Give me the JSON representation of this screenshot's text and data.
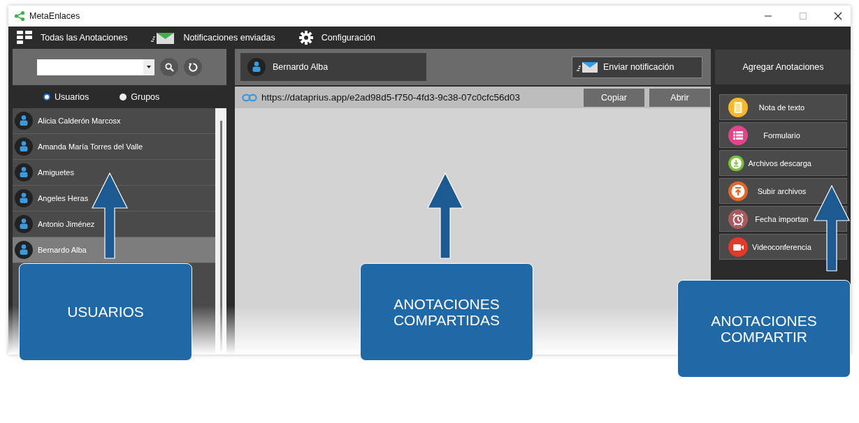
{
  "window": {
    "title": "MetaEnlaces"
  },
  "menu": [
    {
      "label": "Todas las Anotaciones",
      "kind": "grid"
    },
    {
      "label": "Notificaciones enviadas",
      "kind": "mail"
    },
    {
      "label": "Configuración",
      "kind": "gear"
    }
  ],
  "sidebar": {
    "filter": [
      {
        "label": "Usuarios",
        "selected": true
      },
      {
        "label": "Grupos",
        "selected": false
      }
    ],
    "users": [
      {
        "name": "Alicia Calderón Marcosx",
        "selected": false
      },
      {
        "name": "Amanda María Torres del Valle",
        "selected": false
      },
      {
        "name": "Amiguetes",
        "selected": false
      },
      {
        "name": "Angeles Heras",
        "selected": false
      },
      {
        "name": "Antonio Jiménez",
        "selected": false
      },
      {
        "name": "Bernardo Alba",
        "selected": true
      }
    ]
  },
  "conversation": {
    "user": "Bernardo Alba",
    "send_button": "Enviar notificación",
    "link": {
      "url": "https://dataprius.app/e2ad98d5-f750-4fd3-9c38-07c0cfc56d03",
      "buttons": [
        "Copiar",
        "Abrir"
      ]
    }
  },
  "annotations": {
    "title": "Agregar Anotaciones",
    "items": [
      {
        "label": "Nota de texto",
        "kind": "note",
        "color": "#f7b829"
      },
      {
        "label": "Formulario",
        "kind": "form",
        "color": "#e0468c"
      },
      {
        "label": "Archivos descarga",
        "kind": "download",
        "color": "#7cbf3a"
      },
      {
        "label": "Subir archivos",
        "kind": "upload",
        "color": "#e0672a"
      },
      {
        "label": "Fecha importan",
        "kind": "alarm",
        "color": "#a85a5e"
      },
      {
        "label": "Videoconferencia",
        "kind": "video",
        "color": "#e03a2a"
      }
    ]
  },
  "callouts": [
    {
      "label": "USUARIOS"
    },
    {
      "label": "ANOTACIONES COMPARTIDAS"
    },
    {
      "label": "ANOTACIONES COMPARTIR"
    }
  ]
}
